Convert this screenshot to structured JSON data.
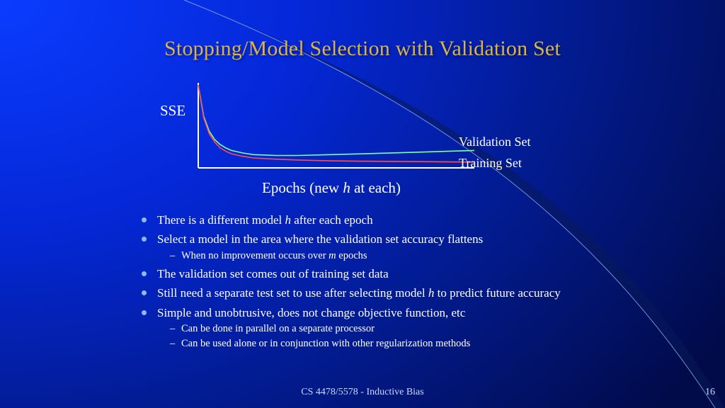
{
  "title": "Stopping/Model Selection with Validation Set",
  "chart_data": {
    "type": "line",
    "xlabel_pre": "Epochs (new ",
    "xlabel_ital": "h",
    "xlabel_post": " at each)",
    "ylabel": "SSE",
    "x": [
      0,
      1,
      2,
      3,
      4,
      5,
      6,
      8,
      10,
      14,
      18,
      24,
      30,
      40,
      50
    ],
    "series": [
      {
        "name": "Validation Set",
        "color": "#7fff9f",
        "values": [
          100,
          62,
          44,
          34,
          28,
          24,
          21,
          18,
          16,
          15,
          15,
          16,
          17,
          19,
          21
        ]
      },
      {
        "name": "Training Set",
        "color": "#ff4d4d",
        "values": [
          100,
          60,
          41,
          31,
          24,
          20,
          17,
          14,
          12,
          10.5,
          9.5,
          8.5,
          8,
          7.5,
          7
        ]
      }
    ],
    "ylim": [
      0,
      100
    ],
    "xlim": [
      0,
      50
    ]
  },
  "legend": {
    "validation": "Validation Set",
    "training": "Training Set"
  },
  "bullets": [
    {
      "text_pre": "There is a different model ",
      "ital": "h",
      "text_post": " after each epoch"
    },
    {
      "text_pre": "Select a model in the area where the validation set accuracy flattens",
      "sub": [
        {
          "pre": "When no improvement occurs over ",
          "ital": "m",
          "post": " epochs"
        }
      ]
    },
    {
      "text_pre": "The validation set comes out of training set data"
    },
    {
      "text_pre": "Still need a separate test set to use after selecting model ",
      "ital": "h",
      "text_post": " to predict future accuracy"
    },
    {
      "text_pre": "Simple and unobtrusive, does not change objective function, etc",
      "sub": [
        {
          "pre": "Can be done in parallel on a separate processor"
        },
        {
          "pre": "Can be used alone or in conjunction with other regularization methods"
        }
      ]
    }
  ],
  "footer": "CS 4478/5578 - Inductive Bias",
  "page": "16"
}
